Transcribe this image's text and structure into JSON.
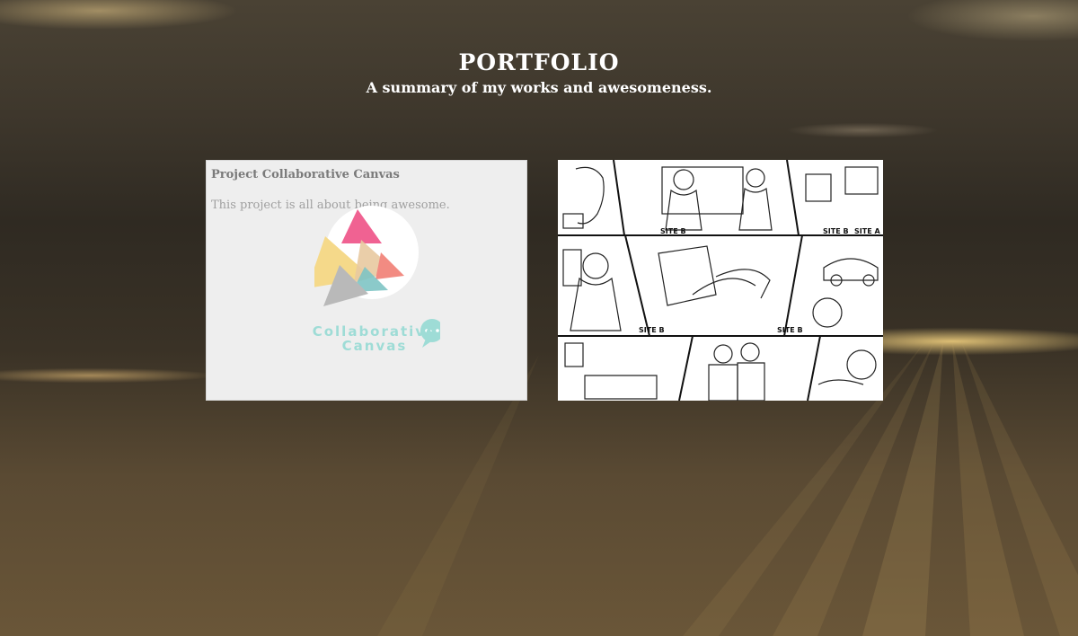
{
  "header": {
    "title": "PORTFOLIO",
    "subtitle": "A summary of my works and awesomeness."
  },
  "projects": [
    {
      "title": "Project Collaborative Canvas",
      "description": "This project is all about being awesome.",
      "logo_line1": "Collaborative",
      "logo_line2": "Canvas"
    },
    {
      "image": "storyboard-comic-illustration",
      "panel_labels": [
        "SITE B",
        "SITE B",
        "SITE A",
        "SITE B",
        "SITE B"
      ]
    }
  ],
  "colors": {
    "title_text": "#ffffff",
    "card_bg": "#eeeeee",
    "logo_teal": "#9edcd6",
    "logo_pink": "#f06292",
    "logo_yellow": "#f5d98a",
    "logo_coral": "#f28b82"
  }
}
